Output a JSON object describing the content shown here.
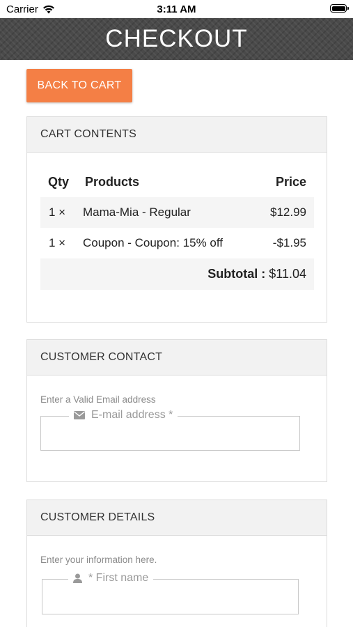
{
  "status_bar": {
    "carrier": "Carrier",
    "time": "3:11 AM"
  },
  "header": {
    "title": "CHECKOUT"
  },
  "back_button": {
    "label": "BACK TO CART",
    "color": "#f47f45"
  },
  "cart": {
    "heading": "CART CONTENTS",
    "columns": {
      "qty": "Qty",
      "products": "Products",
      "price": "Price"
    },
    "items": [
      {
        "qty": "1 ×",
        "product": "Mama-Mia - Regular",
        "price": "$12.99"
      },
      {
        "qty": "1 ×",
        "product": "Coupon - Coupon: 15% off",
        "price": "-$1.95"
      }
    ],
    "subtotal_label": "Subtotal :",
    "subtotal_value": "$11.04"
  },
  "contact": {
    "heading": "CUSTOMER CONTACT",
    "help": "Enter a Valid Email address",
    "email_label": "E-mail address *",
    "email_icon": "envelope-icon"
  },
  "details": {
    "heading": "CUSTOMER DETAILS",
    "help": "Enter your information here.",
    "first_name_label": "* First name",
    "first_name_icon": "user-icon"
  }
}
